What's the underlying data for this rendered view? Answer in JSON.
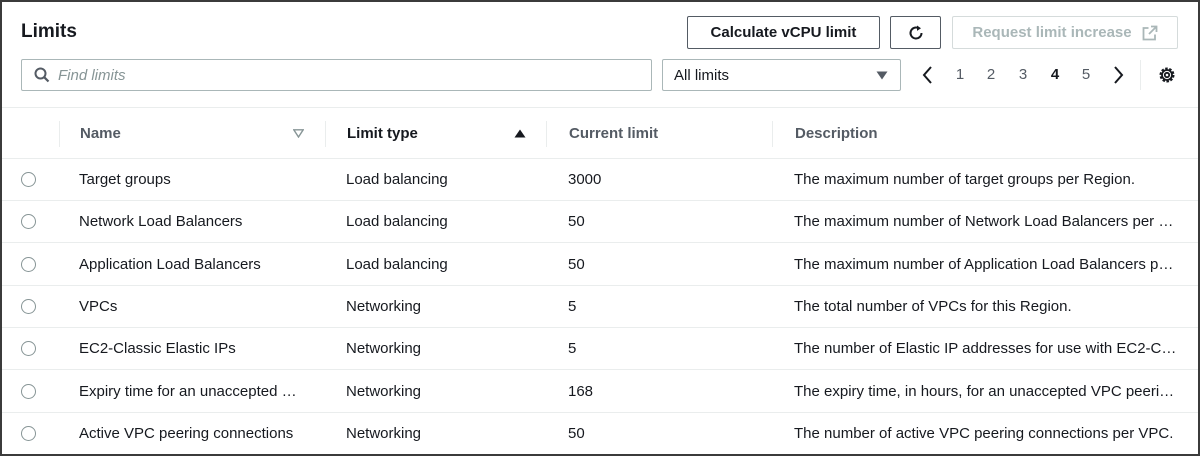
{
  "header": {
    "title": "Limits",
    "calc_button": "Calculate vCPU limit",
    "refresh_icon": "refresh-icon",
    "request_button": "Request limit increase",
    "external_icon": "external-link-icon"
  },
  "search": {
    "placeholder": "Find limits",
    "value": ""
  },
  "filter": {
    "selected": "All limits"
  },
  "pagination": {
    "pages": [
      "1",
      "2",
      "3",
      "4",
      "5"
    ],
    "current": "4"
  },
  "table": {
    "columns": [
      "Name",
      "Limit type",
      "Current limit",
      "Description"
    ],
    "rows": [
      {
        "name": "Target groups",
        "type": "Load balancing",
        "current": "3000",
        "description": "The maximum number of target groups per Region."
      },
      {
        "name": "Network Load Balancers",
        "type": "Load balancing",
        "current": "50",
        "description": "The maximum number of Network Load Balancers per …"
      },
      {
        "name": "Application Load Balancers",
        "type": "Load balancing",
        "current": "50",
        "description": "The maximum number of Application Load Balancers p…"
      },
      {
        "name": "VPCs",
        "type": "Networking",
        "current": "5",
        "description": "The total number of VPCs for this Region."
      },
      {
        "name": "EC2-Classic Elastic IPs",
        "type": "Networking",
        "current": "5",
        "description": "The number of Elastic IP addresses for use with EC2-Cl…"
      },
      {
        "name": "Expiry time for an unaccepted …",
        "type": "Networking",
        "current": "168",
        "description": "The expiry time, in hours, for an unaccepted VPC peeri…"
      },
      {
        "name": "Active VPC peering connections",
        "type": "Networking",
        "current": "50",
        "description": "The number of active VPC peering connections per VPC."
      }
    ]
  },
  "colors": {
    "text": "#16191f",
    "secondary": "#545b64",
    "border": "#aab7b8",
    "divider": "#eaeded"
  }
}
